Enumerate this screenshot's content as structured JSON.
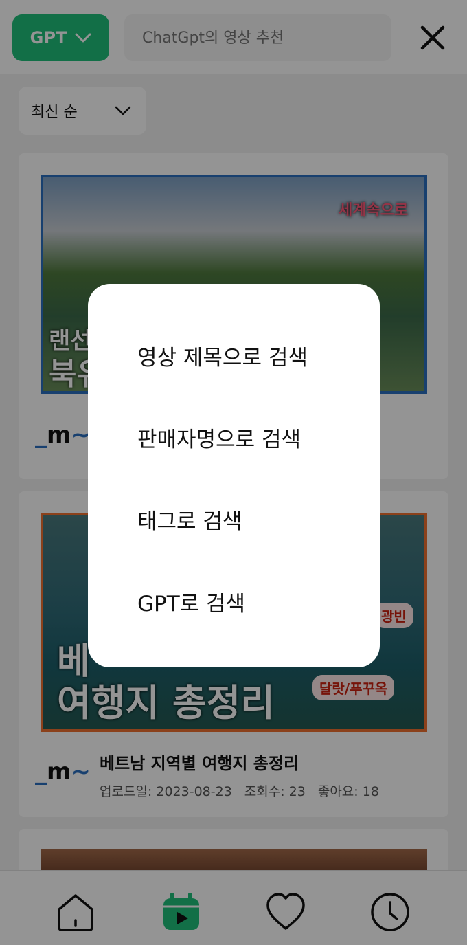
{
  "header": {
    "gpt_button_label": "GPT",
    "search_placeholder": "ChatGpt의 영상 추천",
    "accent_color": "#1fbf7a"
  },
  "sort": {
    "selected": "최신 순"
  },
  "cards": [
    {
      "logo": "m",
      "thumb_text_1": "세계속으로",
      "thumb_text_2": "랜선",
      "thumb_text_3": "북유"
    },
    {
      "logo": "m",
      "title": "베트남 지역별 여행지 총정리",
      "meta": {
        "upload": "업로드일: 2023-08-23",
        "views": "조회수: 23",
        "likes": "좋아요: 18"
      },
      "thumb_text": "여행지 총정리",
      "thumb_text_prefix": "베",
      "tag1": "광빈",
      "tag2": "달랏/푸꾸옥"
    }
  ],
  "dialog": {
    "items": [
      "영상 제목으로 검색",
      "판매자명으로 검색",
      "태그로 검색",
      "GPT로 검색"
    ]
  },
  "nav": {
    "icons": [
      "home-icon",
      "video-calendar-icon",
      "heart-icon",
      "clock-icon"
    ]
  }
}
